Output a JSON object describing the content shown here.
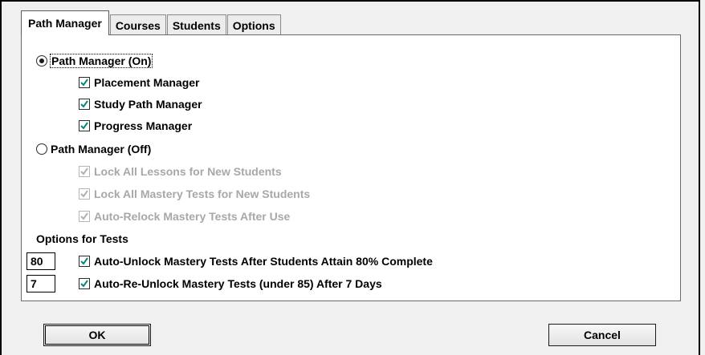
{
  "tabs": [
    {
      "label": "Path Manager",
      "active": true
    },
    {
      "label": "Courses",
      "active": false
    },
    {
      "label": "Students",
      "active": false
    },
    {
      "label": "Options",
      "active": false
    }
  ],
  "path_on": {
    "label": "Path Manager (On)",
    "selected": true,
    "options": [
      {
        "label": "Placement Manager",
        "checked": true
      },
      {
        "label": "Study Path Manager",
        "checked": true
      },
      {
        "label": "Progress Manager",
        "checked": true
      }
    ]
  },
  "path_off": {
    "label": "Path Manager (Off)",
    "selected": false,
    "options": [
      {
        "label": "Lock All Lessons for New Students",
        "checked": true,
        "disabled": true
      },
      {
        "label": "Lock All Mastery Tests for New Students",
        "checked": true,
        "disabled": true
      },
      {
        "label": "Auto-Relock Mastery Tests After Use",
        "checked": true,
        "disabled": true
      }
    ]
  },
  "tests": {
    "heading": "Options for Tests",
    "items": [
      {
        "value": "80",
        "label": "Auto-Unlock Mastery Tests After Students Attain 80% Complete",
        "checked": true
      },
      {
        "value": "7",
        "label": "Auto-Re-Unlock Mastery Tests (under 85) After 7 Days",
        "checked": true
      }
    ]
  },
  "buttons": {
    "ok": "OK",
    "cancel": "Cancel"
  },
  "colors": {
    "check_enabled": "#00897b",
    "check_disabled": "#b0b0b0",
    "text_disabled": "#a8a8a8"
  }
}
